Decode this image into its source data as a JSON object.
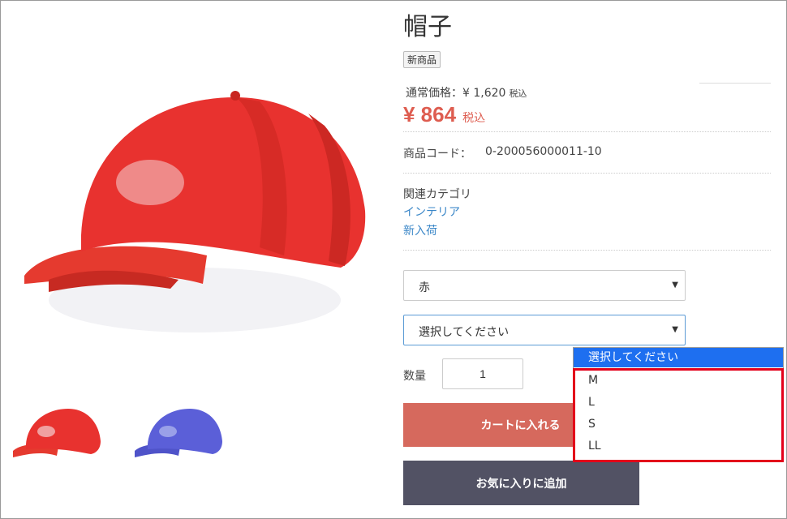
{
  "product": {
    "title": "帽子",
    "badge": "新商品",
    "regular_price_label": "通常価格：",
    "regular_price_value": "¥ 1,620",
    "tax_label": "税込",
    "sale_price": "¥ 864",
    "sale_tax_label": "税込",
    "code_label": "商品コード：",
    "code_value": "0-200056000011-10",
    "category_label": "関連カテゴリ",
    "categories": [
      "インテリア",
      "新入荷"
    ]
  },
  "options": {
    "color_select_value": "赤",
    "size_select_value": "選択してください",
    "size_dropdown_options": [
      "選択してください",
      "M",
      "L",
      "S",
      "LL"
    ],
    "highlighted_option": "選択してください"
  },
  "quantity": {
    "label": "数量",
    "value": "1"
  },
  "actions": {
    "add_to_cart": "カートに入れる",
    "add_to_favorite": "お気に入りに追加"
  },
  "icons": {
    "caret": "chevron-down-icon"
  },
  "colors": {
    "sale_price": "#de5d50",
    "cart_button": "#d6695d",
    "favorite_button": "#525264",
    "dropdown_highlight": "#1e6ff0",
    "annotation_box": "#e3001a",
    "red_cap": "#e8322f",
    "blue_cap": "#5b5fd8"
  }
}
